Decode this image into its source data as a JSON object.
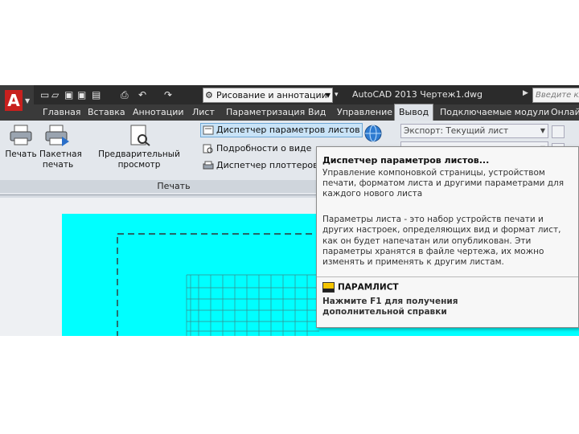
{
  "app": {
    "title": "AutoCAD 2013   Чертеж1.dwg",
    "logo": "A",
    "workspace": "Рисование и аннотации",
    "search_placeholder": "Введите кл"
  },
  "tabs": [
    {
      "label": "Главная",
      "active": false
    },
    {
      "label": "Вставка",
      "active": false
    },
    {
      "label": "Аннотации",
      "active": false
    },
    {
      "label": "Лист",
      "active": false
    },
    {
      "label": "Параметризация",
      "active": false
    },
    {
      "label": "Вид",
      "active": false
    },
    {
      "label": "Управление",
      "active": false
    },
    {
      "label": "Вывод",
      "active": true
    },
    {
      "label": "Подключаемые модули",
      "active": false
    },
    {
      "label": "Онлай",
      "active": false
    }
  ],
  "ribbon": {
    "plot_button": "Печать",
    "batch_plot_line1": "Пакетная",
    "batch_plot_line2": "печать",
    "preview_button": "Предварительный просмотр",
    "page_setup_manager": "Диспетчер параметров листов",
    "view_details": "Подробности о виде",
    "plotter_manager": "Диспетчер плоттеров",
    "panel_label": "Печать",
    "export_combo": "Экспорт: Текущий лист",
    "second_combo": ""
  },
  "tooltip": {
    "title": "Диспетчер параметров листов...",
    "description": "Управление компоновкой страницы, устройством печати, форматом листа и другими параметрами для каждого нового листа",
    "extended": "Параметры листа - это набор устройств печати и других настроек, определяющих вид и формат лист, как он будет напечатан или опубликован. Эти параметры хранятся в файле чертежа, их можно изменять и применять к другим листам.",
    "command": "ПАРАМЛИСТ",
    "help_line1": "Нажмите F1 для получения",
    "help_line2": "дополнительной справки"
  },
  "colors": {
    "paper": "#00ffff",
    "accent": "#c8201e",
    "ribbon": "#e3e7ec"
  }
}
